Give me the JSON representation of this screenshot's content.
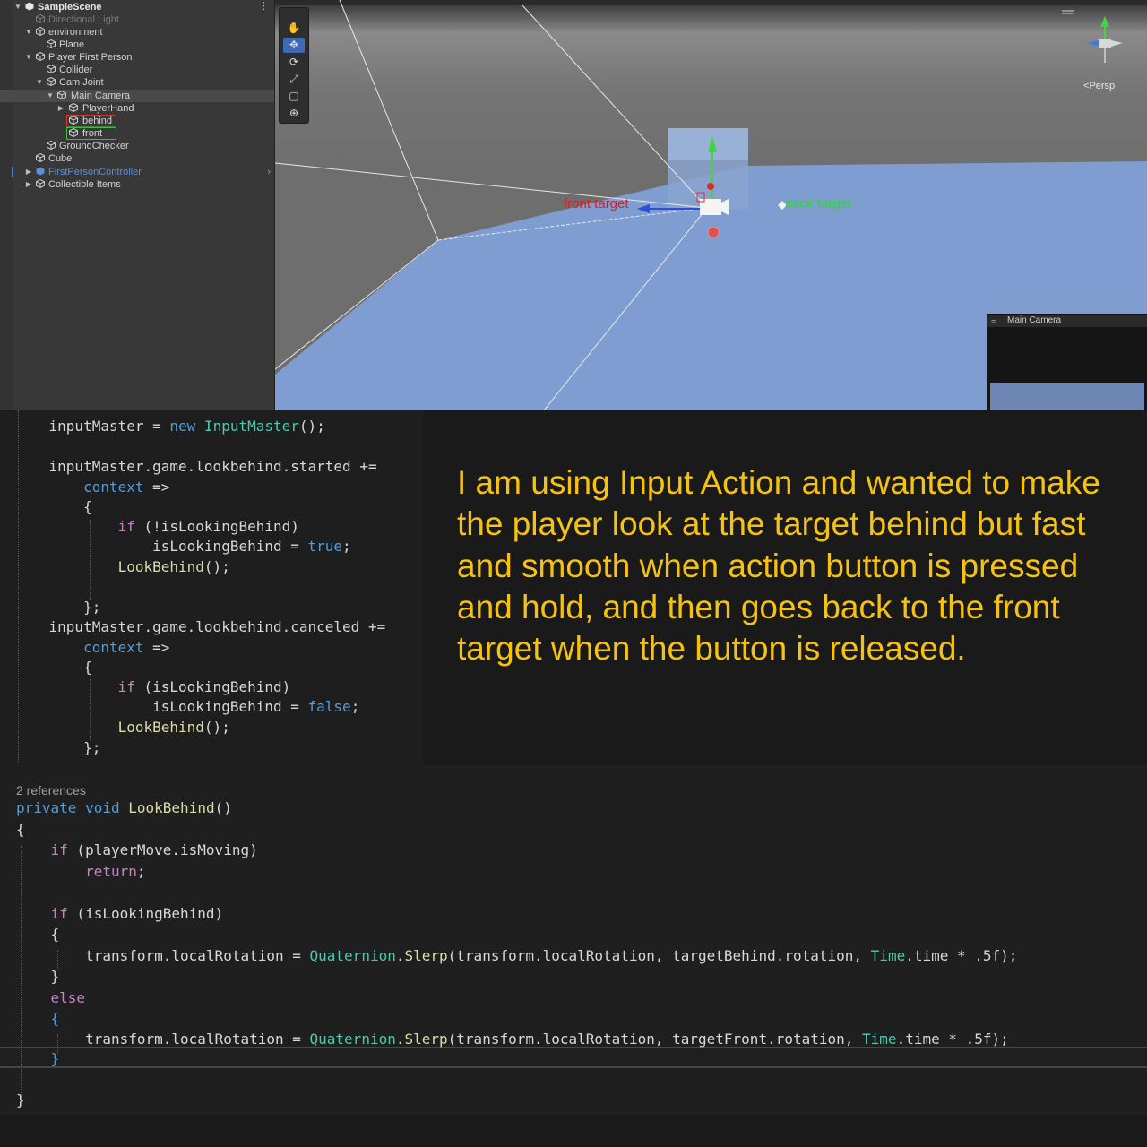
{
  "hierarchy": {
    "scene": "SampleScene",
    "items": [
      {
        "label": "Directional Light"
      },
      {
        "label": "environment"
      },
      {
        "label": "Plane"
      },
      {
        "label": "Player First Person"
      },
      {
        "label": "Collider"
      },
      {
        "label": "Cam Joint"
      },
      {
        "label": "Main Camera"
      },
      {
        "label": "PlayerHand"
      },
      {
        "label": "behind"
      },
      {
        "label": "front"
      },
      {
        "label": "GroundChecker"
      },
      {
        "label": "Cube"
      },
      {
        "label": "FirstPersonController"
      },
      {
        "label": "Collectible Items"
      }
    ]
  },
  "scene_view": {
    "front_label": "front target",
    "back_label": "back target",
    "projection": "Persp",
    "camera_preview_title": "Main Camera",
    "tools": [
      "hand-tool-icon",
      "move-tool-icon",
      "rotate-tool-icon",
      "scale-tool-icon",
      "rect-tool-icon",
      "transform-tool-icon"
    ]
  },
  "code_top": {
    "l1": [
      "inputMaster",
      " = ",
      "new",
      " ",
      "InputMaster",
      "();"
    ],
    "l2": "inputMaster.game.lookbehind.started +=",
    "l3": "context",
    "l3b": " =>",
    "l4": "{",
    "l5a": "if",
    "l5b": " (!isLookingBehind)",
    "l6a": "isLookingBehind = ",
    "l6b": "true",
    "l6c": ";",
    "l7a": "LookBehind",
    "l7b": "();",
    "l8": "};",
    "l9": "inputMaster.game.lookbehind.canceled +=",
    "l10": "context",
    "l11": "{",
    "l12a": "if",
    "l12b": " (isLookingBehind)",
    "l13a": "isLookingBehind = ",
    "l13b": "false",
    "l13c": ";",
    "l14a": "LookBehind",
    "l14b": "();",
    "l15": "};"
  },
  "question": "I am using Input Action and wanted to make the player look at the target behind but fast and smooth when action button is pressed and hold, and then goes back to the front target when the button is released.",
  "code_bottom": {
    "refs": "2 references",
    "sig_private": "private",
    "sig_void": "void",
    "sig_name": "LookBehind",
    "sig_paren": "()",
    "open": "{",
    "if1": "if",
    "if1_cond": " (playerMove.isMoving)",
    "ret": "return",
    "ret_semi": ";",
    "if2": "if",
    "if2_cond": " (isLookingBehind)",
    "brace_open": "{",
    "slerp_lhs": "transform.localRotation = ",
    "quat": "Quaternion",
    "dot": ".",
    "slerp": "Slerp",
    "args_behind_a": "(transform.localRotation, targetBehind.rotation, ",
    "time": "Time",
    "args_tail": ".time * .5f);",
    "brace_close": "}",
    "else": "else",
    "args_front_a": "(transform.localRotation, targetFront.rotation, ",
    "close": "}"
  }
}
